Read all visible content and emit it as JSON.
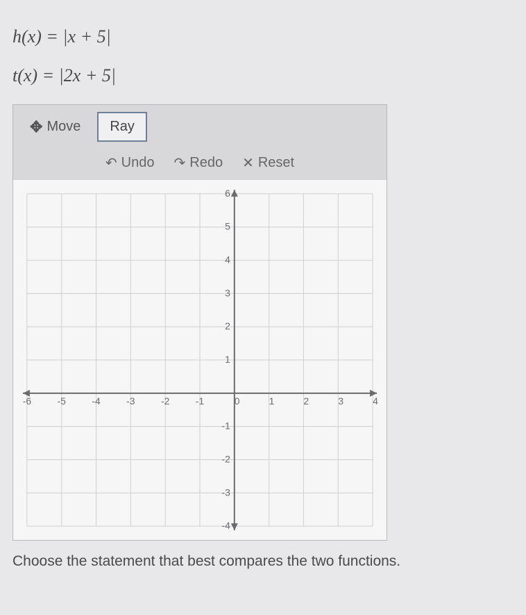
{
  "equations": {
    "h": "h(x) = |x + 5|",
    "t": "t(x) = |2x + 5|"
  },
  "toolbar": {
    "move_label": "Move",
    "ray_label": "Ray",
    "undo_label": "Undo",
    "redo_label": "Redo",
    "reset_label": "Reset"
  },
  "prompt": "Choose the statement that best compares the two functions.",
  "chart_data": {
    "type": "scatter",
    "title": "",
    "xlabel": "",
    "ylabel": "",
    "xlim": [
      -6,
      4
    ],
    "ylim": [
      -4,
      6
    ],
    "x_ticks": [
      -6,
      -5,
      -4,
      -3,
      -2,
      -1,
      0,
      1,
      2,
      3,
      4
    ],
    "y_ticks": [
      -4,
      -3,
      -2,
      -1,
      1,
      2,
      3,
      4,
      5,
      6
    ],
    "series": []
  }
}
